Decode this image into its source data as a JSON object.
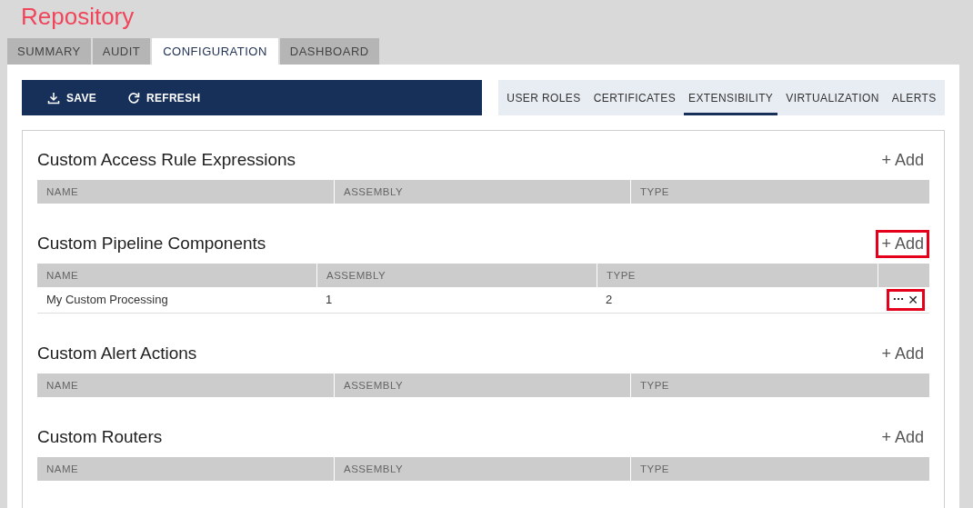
{
  "app_title": "Repository",
  "tabs": [
    {
      "label": "SUMMARY",
      "selected": false
    },
    {
      "label": "AUDIT",
      "selected": false
    },
    {
      "label": "CONFIGURATION",
      "selected": true
    },
    {
      "label": "DASHBOARD",
      "selected": false
    }
  ],
  "toolbar": [
    {
      "label": "SAVE",
      "kind": "save"
    },
    {
      "label": "REFRESH",
      "kind": "refresh"
    }
  ],
  "subtabs": [
    {
      "label": "USER ROLES",
      "selected": false
    },
    {
      "label": "CERTIFICATES",
      "selected": false
    },
    {
      "label": "EXTENSIBILITY",
      "selected": true
    },
    {
      "label": "VIRTUALIZATION",
      "selected": false
    },
    {
      "label": "ALERTS",
      "selected": false
    }
  ],
  "sections": [
    {
      "title": "Custom Access Rule Expressions",
      "add": {
        "label": "+ Add",
        "highlighted": false
      },
      "columns": [
        "NAME",
        "ASSEMBLY",
        "TYPE"
      ]
    },
    {
      "title": "Custom Pipeline Components",
      "add": {
        "label": "+ Add",
        "highlighted": true
      },
      "columns": [
        "NAME",
        "ASSEMBLY",
        "TYPE"
      ],
      "rows": [
        {
          "cells": [
            "My Custom Processing",
            "1",
            "2"
          ],
          "actions": {
            "more": "···",
            "remove": "✕",
            "highlighted": true
          }
        }
      ]
    },
    {
      "title": "Custom Alert Actions",
      "add": {
        "label": "+ Add",
        "highlighted": false
      },
      "columns": [
        "NAME",
        "ASSEMBLY",
        "TYPE"
      ]
    },
    {
      "title": "Custom Routers",
      "add": {
        "label": "+ Add",
        "highlighted": false
      },
      "columns": [
        "NAME",
        "ASSEMBLY",
        "TYPE"
      ]
    }
  ]
}
